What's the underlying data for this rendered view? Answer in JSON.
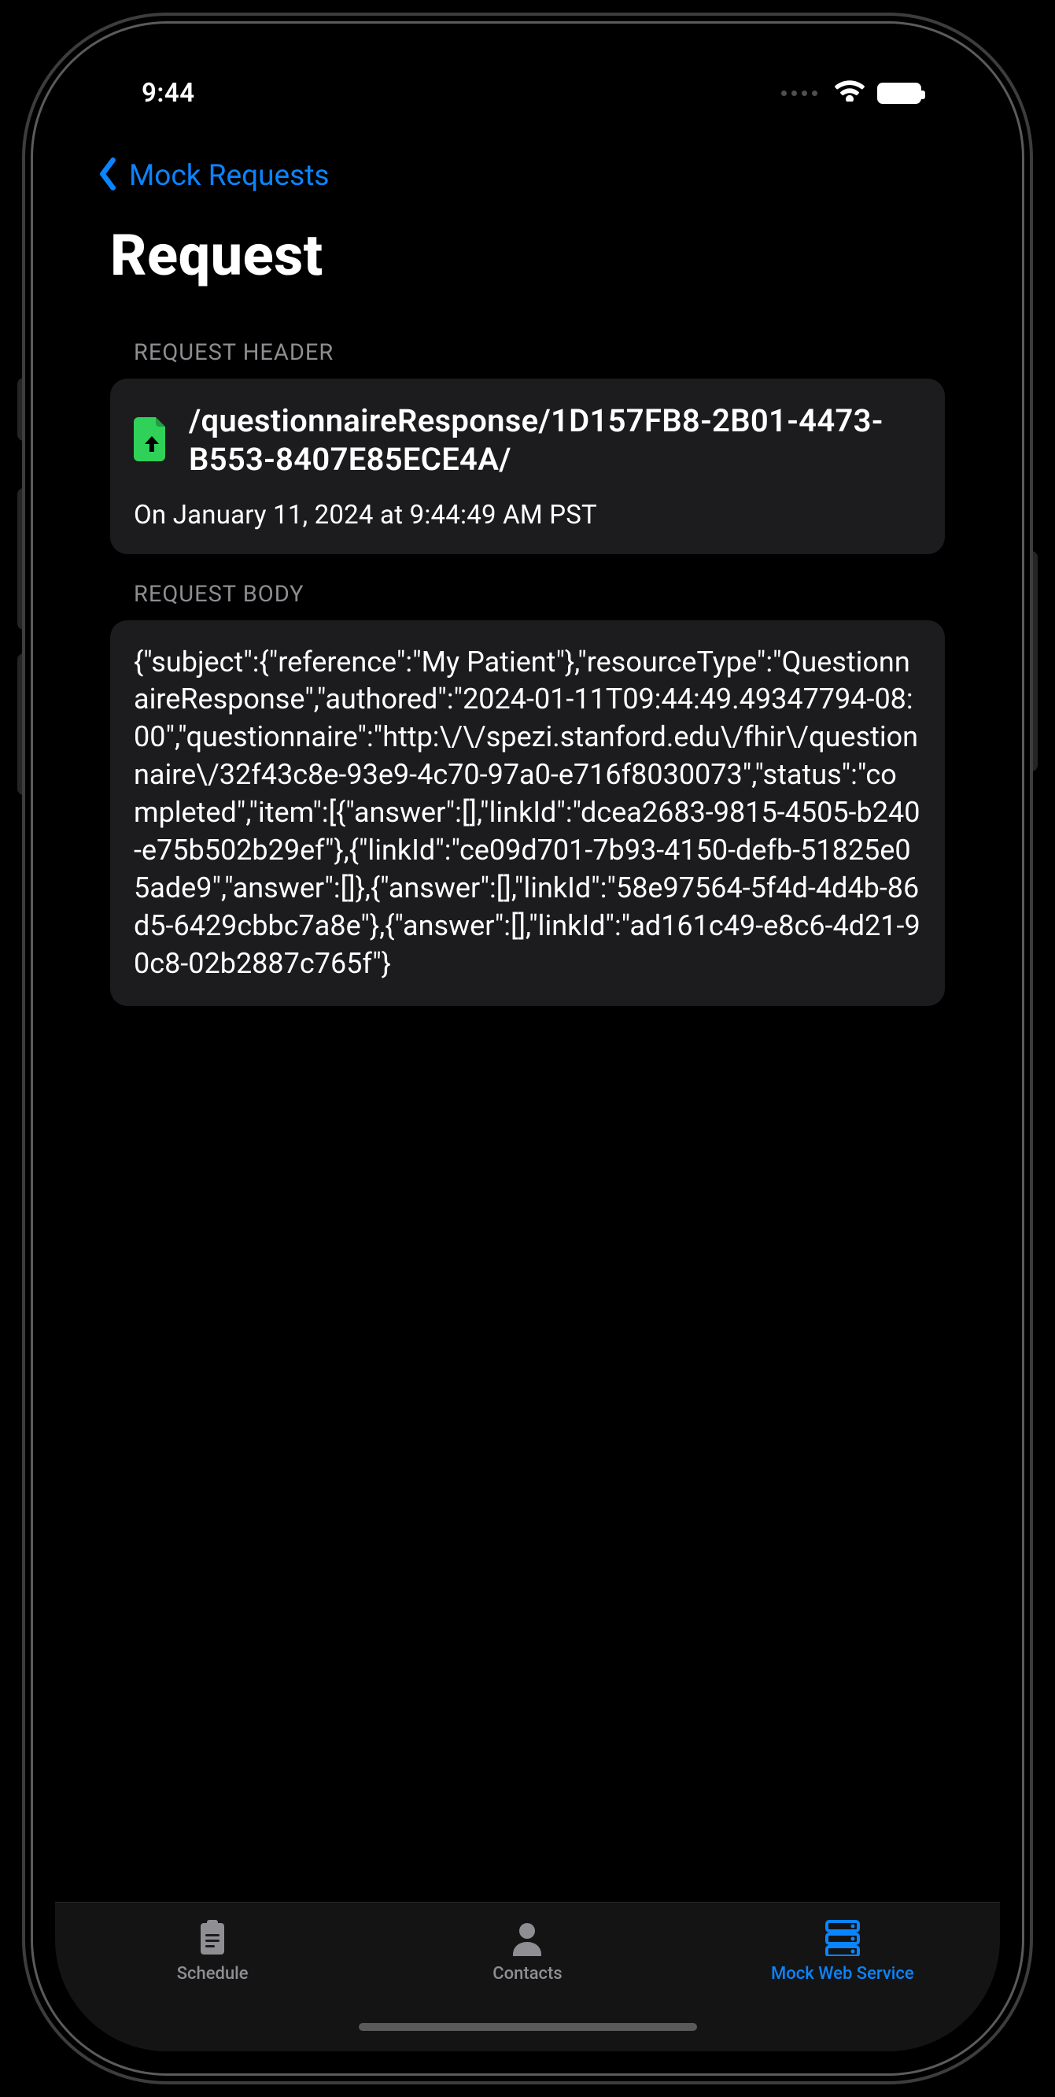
{
  "status": {
    "time": "9:44"
  },
  "nav": {
    "back_label": "Mock Requests",
    "title": "Request"
  },
  "request_header": {
    "section": "REQUEST HEADER",
    "icon_accent": "#30d158",
    "path": "/questionnaireResponse/1D157FB8-2B01-4473-B553-8407E85ECE4A/",
    "timestamp_label": "On January 11, 2024 at 9:44:49 AM PST"
  },
  "request_body": {
    "section": "REQUEST BODY",
    "body": "{\"subject\":{\"reference\":\"My Patient\"},\"resourceType\":\"QuestionnaireResponse\",\"authored\":\"2024-01-11T09:44:49.49347794-08:00\",\"questionnaire\":\"http:\\/\\/spezi.stanford.edu\\/fhir\\/questionnaire\\/32f43c8e-93e9-4c70-97a0-e716f8030073\",\"status\":\"completed\",\"item\":[{\"answer\":[],\"linkId\":\"dcea2683-9815-4505-b240-e75b502b29ef\"},{\"linkId\":\"ce09d701-7b93-4150-defb-51825e05ade9\",\"answer\":[]},{\"answer\":[],\"linkId\":\"58e97564-5f4d-4d4b-86d5-6429cbbc7a8e\"},{\"answer\":[],\"linkId\":\"ad161c49-e8c6-4d21-90c8-02b2887c765f\"}"
  },
  "tabs": {
    "items": [
      {
        "label": "Schedule"
      },
      {
        "label": "Contacts"
      },
      {
        "label": "Mock Web Service"
      }
    ]
  }
}
